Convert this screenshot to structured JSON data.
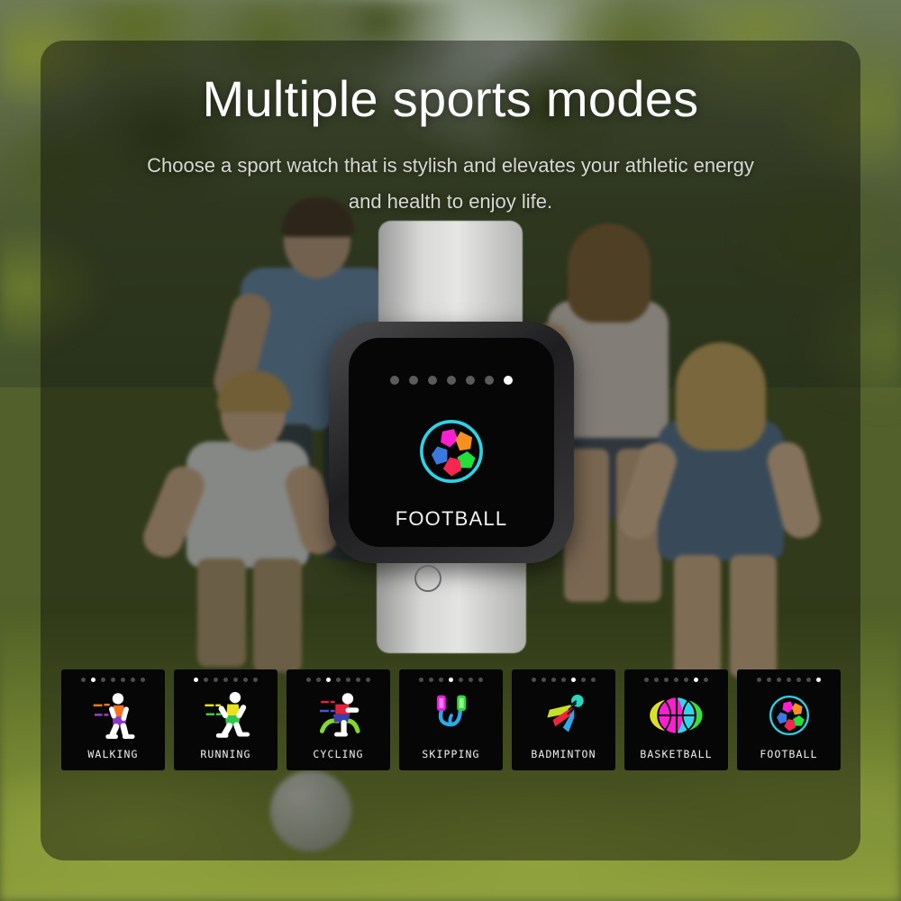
{
  "hero": {
    "title": "Multiple sports modes",
    "subtitle": "Choose a sport watch that is stylish and elevates your athletic energy and health to enjoy life."
  },
  "watch": {
    "current_mode_label": "FOOTBALL",
    "current_mode_icon": "football-icon",
    "page_dots_total": 7,
    "page_dots_active_index": 7,
    "home_button": "home-button",
    "strap_color": "#d8d8d6",
    "body_color": "#2a2a2c",
    "screen_color": "#060606"
  },
  "colors": {
    "title_text": "#ffffff",
    "subtitle_text": "#d6d9d2",
    "active_dot": "#ffffff",
    "inactive_dot": "#5b5b5b",
    "overlay": "rgba(10,14,8,0.46)",
    "football_outline": "#2ad4e6",
    "football_magenta": "#f81fd0",
    "football_orange": "#f79020",
    "football_blue": "#3a7ae0",
    "football_green": "#22e03a",
    "football_red": "#f5274f"
  },
  "modes": [
    {
      "label": "WALKING",
      "icon": "walking-icon",
      "dots_total": 7,
      "dot_active": 1
    },
    {
      "label": "RUNNING",
      "icon": "running-icon",
      "dots_total": 7,
      "dot_active": 0
    },
    {
      "label": "CYCLING",
      "icon": "cycling-icon",
      "dots_total": 7,
      "dot_active": 2
    },
    {
      "label": "SKIPPING",
      "icon": "skipping-icon",
      "dots_total": 7,
      "dot_active": 3
    },
    {
      "label": "BADMINTON",
      "icon": "badminton-icon",
      "dots_total": 7,
      "dot_active": 4
    },
    {
      "label": "BASKETBALL",
      "icon": "basketball-icon",
      "dots_total": 7,
      "dot_active": 5
    },
    {
      "label": "FOOTBALL",
      "icon": "football-icon",
      "dots_total": 7,
      "dot_active": 6
    }
  ]
}
